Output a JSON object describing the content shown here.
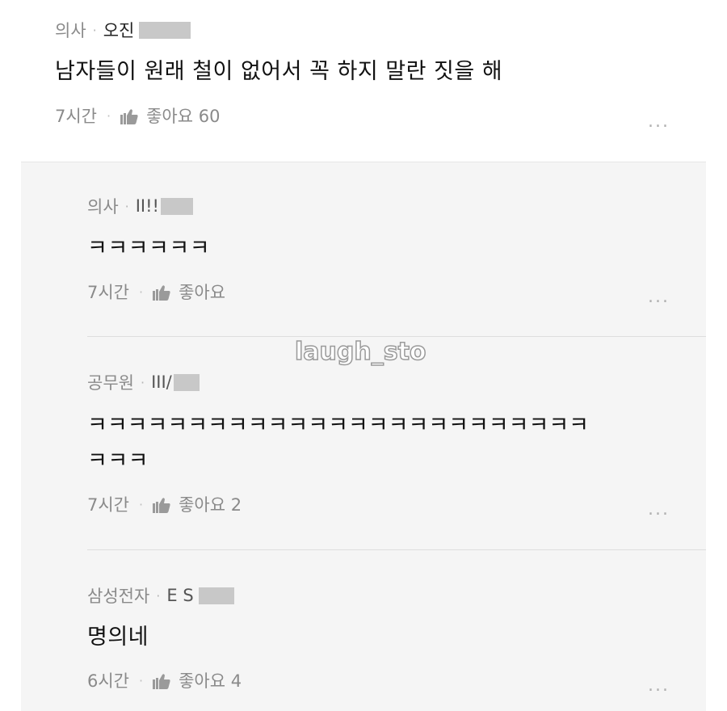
{
  "main_comment": {
    "author_job": "의사",
    "author_name": "오진",
    "text": "남자들이 원래 철이 없어서 꼭 하지 말란 짓을 해",
    "time": "7시간",
    "like_label": "좋아요 60",
    "more": "..."
  },
  "replies": [
    {
      "author_job": "의사",
      "author_name": "II!!",
      "text": "ㅋㅋㅋㅋㅋㅋ",
      "time": "7시간",
      "like_label": "좋아요",
      "more": "..."
    },
    {
      "author_job": "공무원",
      "author_name": "III/",
      "text_line1": "ㅋㅋㅋㅋㅋㅋㅋㅋㅋㅋㅋㅋㅋㅋㅋㅋㅋㅋㅋㅋㅋㅋㅋㅋㅋ",
      "text_line2": "ㅋㅋㅋ",
      "time": "7시간",
      "like_label": "좋아요 2",
      "more": "..."
    },
    {
      "author_job": "삼성전자",
      "author_name": "E S",
      "text": "명의네",
      "time": "6시간",
      "like_label": "좋아요 4",
      "more": "..."
    }
  ],
  "watermark": "laugh_sto",
  "icons": {
    "like": "thumbs-up-icon",
    "more": "more-options-icon"
  },
  "colors": {
    "reply_background": "#f5f5f5",
    "meta_text": "#8a8a8a",
    "censor_block": "#c8c8c8"
  }
}
